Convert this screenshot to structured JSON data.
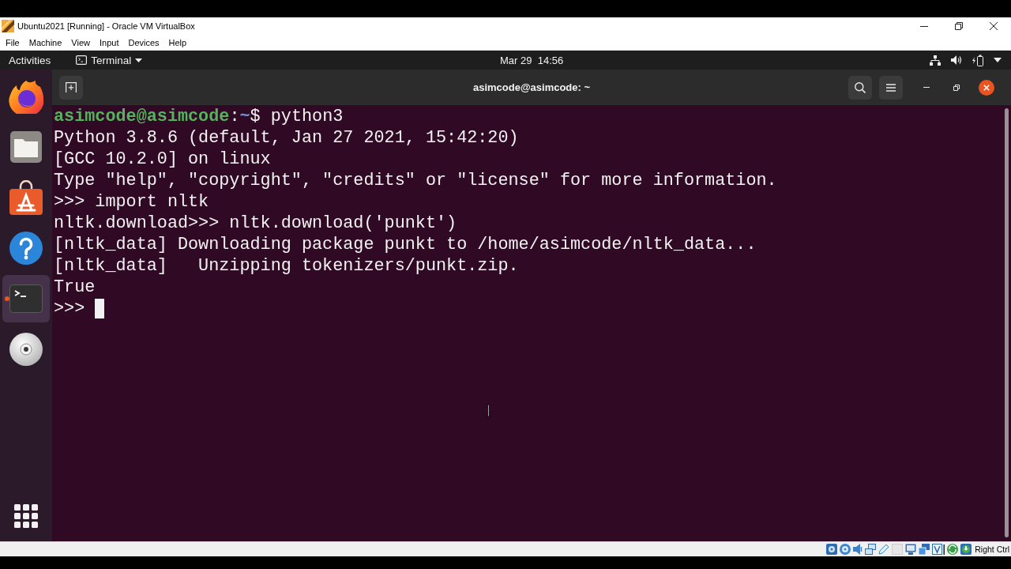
{
  "vbox_window": {
    "title": "Ubuntu2021 [Running] - Oracle VM VirtualBox",
    "menu": [
      "File",
      "Machine",
      "View",
      "Input",
      "Devices",
      "Help"
    ]
  },
  "top_bar": {
    "activities": "Activities",
    "app_menu": "Terminal",
    "clock": "Mar 29  14:56"
  },
  "dock": {
    "items": [
      {
        "kind": "browser",
        "selected": false,
        "running": false
      },
      {
        "kind": "files",
        "selected": false,
        "running": false
      },
      {
        "kind": "software",
        "selected": false,
        "running": false
      },
      {
        "kind": "help",
        "selected": false,
        "running": false
      },
      {
        "kind": "terminal",
        "selected": true,
        "running": true
      },
      {
        "kind": "disc",
        "selected": false,
        "running": false
      }
    ]
  },
  "terminal": {
    "title": "asimcode@asimcode: ~",
    "lines": [
      {
        "kind": "prompt",
        "user": "asimcode@asimcode",
        "separator": ":",
        "path": "~",
        "symbol": "$",
        "command": "python3",
        "cursor": false
      },
      {
        "kind": "output",
        "text": "Python 3.8.6 (default, Jan 27 2021, 15:42:20)",
        "cursor": false
      },
      {
        "kind": "output",
        "text": "[GCC 10.2.0] on linux",
        "cursor": false
      },
      {
        "kind": "output",
        "text": "Type \"help\", \"copyright\", \"credits\" or \"license\" for more information.",
        "cursor": false
      },
      {
        "kind": "output",
        "text": ">>> import nltk",
        "cursor": false
      },
      {
        "kind": "output",
        "text": "nltk.download>>> nltk.download('punkt')",
        "cursor": false
      },
      {
        "kind": "output",
        "text": "[nltk_data] Downloading package punkt to /home/asimcode/nltk_data...",
        "cursor": false
      },
      {
        "kind": "output",
        "text": "[nltk_data]   Unzipping tokenizers/punkt.zip.",
        "cursor": false
      },
      {
        "kind": "output",
        "text": "True",
        "cursor": false
      },
      {
        "kind": "output",
        "text": ">>>",
        "cursor": true
      }
    ]
  },
  "status_bar": {
    "host_key": "Right Ctrl"
  }
}
